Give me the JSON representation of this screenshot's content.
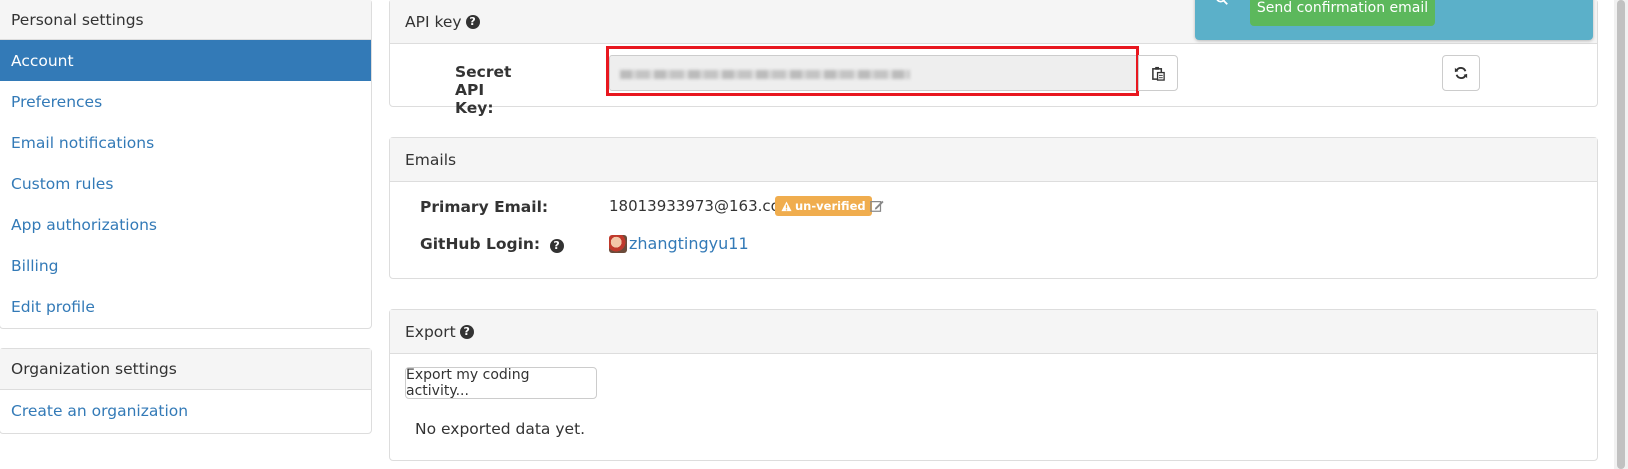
{
  "sidebar": {
    "personal_heading": "Personal settings",
    "items": [
      {
        "label": "Account",
        "active": true
      },
      {
        "label": "Preferences"
      },
      {
        "label": "Email notifications"
      },
      {
        "label": "Custom rules"
      },
      {
        "label": "App authorizations"
      },
      {
        "label": "Billing"
      },
      {
        "label": "Edit profile"
      }
    ],
    "org_heading": "Organization settings",
    "org_items": [
      {
        "label": "Create an organization"
      }
    ]
  },
  "api_key": {
    "heading": "API key",
    "help_icon": "question-circle-icon",
    "label": "Secret API Key:",
    "copy_icon": "clipboard-icon",
    "refresh_icon": "refresh-icon"
  },
  "emails": {
    "heading": "Emails",
    "primary_label": "Primary Email:",
    "primary_value": "18013933973@163.com",
    "badge": "un-verified",
    "edit_icon": "edit-icon",
    "github_label": "GitHub Login:",
    "github_user": "zhangtingyu11"
  },
  "export": {
    "heading": "Export",
    "button": "Export my coding activity...",
    "empty": "No exported data yet."
  },
  "toast": {
    "button": "Send confirmation email"
  },
  "colors": {
    "accent": "#337ab7",
    "warning": "#f0ad4e",
    "success": "#5cb85c",
    "info": "#5bb0c9",
    "highlight": "#e8171f"
  }
}
